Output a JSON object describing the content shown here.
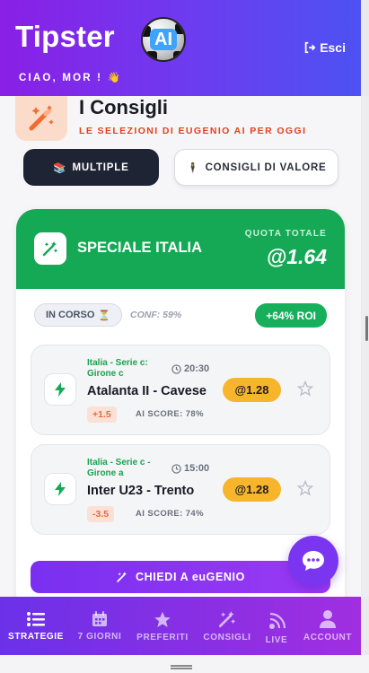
{
  "header": {
    "title": "Tipster",
    "logo_badge": "AI",
    "logout_label": "Esci",
    "greeting": "CIAO, MOR ! 👋",
    "colors": {
      "gradient_start": "#8a1fe6",
      "gradient_end": "#4d52f2"
    }
  },
  "section": {
    "title": "I Consigli",
    "subtitle": "LE SELEZIONI DI EUGENIO AI PER OGGI",
    "icon": "magic-wand-icon"
  },
  "tabs": [
    {
      "label": "MULTIPLE",
      "emoji": "📚",
      "active": true
    },
    {
      "label": "CONSIGLI DI VALORE",
      "emoji": "🕴",
      "active": false
    }
  ],
  "card": {
    "title": "SPECIALE ITALIA",
    "quota_label": "QUOTA TOTALE",
    "quota_value": "@1.64",
    "status": "IN CORSO",
    "status_emoji": "⏳",
    "confidence": "CONF: 59%",
    "roi": "+64% ROI",
    "accent": "#15a956"
  },
  "matches": [
    {
      "league": "Italia - Serie c: Girone c",
      "time": "20:30",
      "teams": "Atalanta II - Cavese",
      "tag": "+1.5",
      "ai_score": "AI SCORE: 78%",
      "odds": "@1.28"
    },
    {
      "league": "Italia - Serie c - Girone a",
      "time": "15:00",
      "teams": "Inter U23 - Trento",
      "tag": "-3.5",
      "ai_score": "AI SCORE: 74%",
      "odds": "@1.28"
    }
  ],
  "ask_button": "CHIEDI A euGENIO",
  "nav": [
    {
      "label": "STRATEGIE",
      "icon": "list-icon",
      "active": true
    },
    {
      "label": "7 GIORNI",
      "icon": "calendar-icon",
      "active": false
    },
    {
      "label": "PREFERITI",
      "icon": "star-icon",
      "active": false
    },
    {
      "label": "CONSIGLI",
      "icon": "magic-wand-icon",
      "active": false
    },
    {
      "label": "LIVE",
      "icon": "live-signal-icon",
      "active": false
    },
    {
      "label": "ACCOUNT",
      "icon": "user-icon",
      "active": false
    }
  ]
}
